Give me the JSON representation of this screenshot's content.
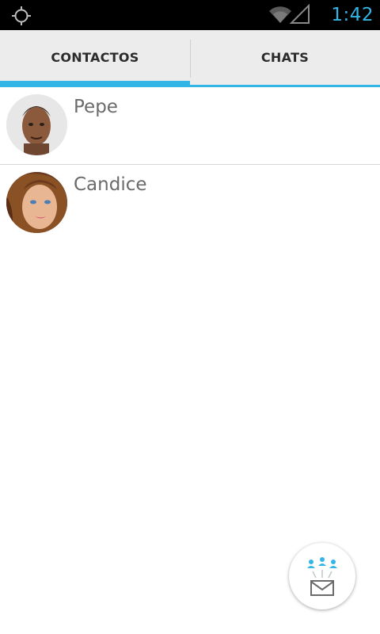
{
  "status_bar": {
    "time": "1:42",
    "icons": [
      "gps-icon",
      "wifi-icon",
      "signal-icon"
    ],
    "clock_color": "#33b5e5"
  },
  "tabs": [
    {
      "label": "CONTACTOS",
      "active": true
    },
    {
      "label": "CHATS",
      "active": false
    }
  ],
  "accent_color": "#33b5e5",
  "contacts": [
    {
      "name": "Pepe",
      "avatar": "avatar-photo-male"
    },
    {
      "name": "Candice",
      "avatar": "avatar-photo-female"
    }
  ],
  "fab": {
    "icon": "group-message-icon"
  }
}
